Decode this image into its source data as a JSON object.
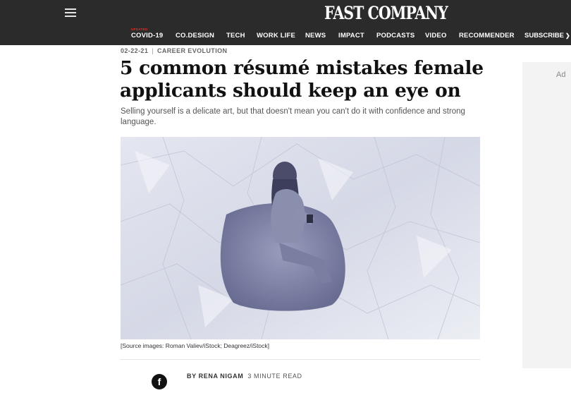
{
  "header": {
    "logo": "FAST COMPANY",
    "covid_tag": "UPDATED",
    "nav": [
      "COVID-19",
      "CO.DESIGN",
      "TECH",
      "WORK LIFE",
      "NEWS",
      "IMPACT",
      "PODCASTS",
      "VIDEO",
      "RECOMMENDER"
    ],
    "subscribe": "SUBSCRIBE",
    "colors": {
      "bar": "#2b2b2b",
      "covid_accent": "#e0312a"
    }
  },
  "article": {
    "date": "02-22-21",
    "separator": "|",
    "category": "CAREER EVOLUTION",
    "headline": "5 common résumé mistakes female applicants should keep an eye on",
    "dek": "Selling yourself is a delicate art, but that doesn't mean you can't do it with confidence and strong language.",
    "image_caption": "[Source images: Roman Valiev/iStock; Deagreez/iStock]",
    "byline": "BY RENA NIGAM",
    "read_time": "3 MINUTE READ"
  },
  "share": {
    "facebook_glyph": "f"
  },
  "ad": {
    "label": "Ad"
  }
}
